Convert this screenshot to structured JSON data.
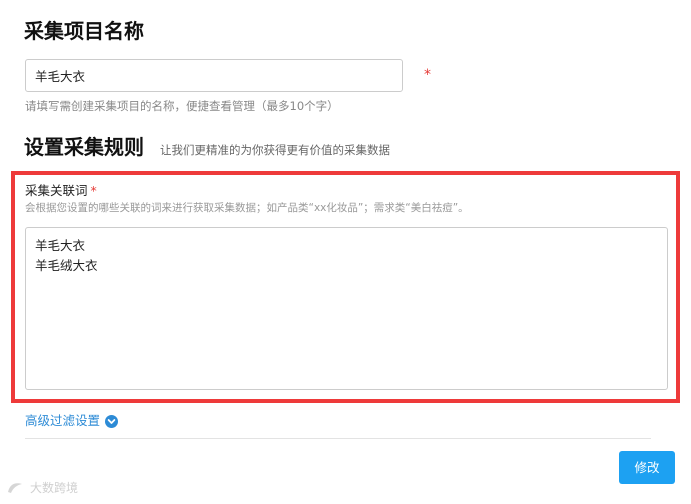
{
  "form": {
    "project_name_title": "采集项目名称",
    "project_name_value": "羊毛大衣",
    "required_mark": "*",
    "project_name_help": "请填写需创建采集项目的名称，便捷查看管理（最多10个字）",
    "rules_title": "设置采集规则",
    "rules_subtitle": "让我们更精准的为你获得更有价值的采集数据",
    "keywords_label": "采集关联词",
    "keywords_hint": "会根据您设置的哪些关联的词来进行获取采集数据；如产品类“xx化妆品”；需求类“美白祛痘”。",
    "keywords": [
      "羊毛大衣",
      "羊毛绒大衣"
    ],
    "advanced_filter_label": "高级过滤设置",
    "submit_label": "修改"
  },
  "watermark": {
    "text": "大数跨境"
  },
  "colors": {
    "highlight_border": "#ee3a3a",
    "link": "#2d8bd6",
    "primary_button": "#1da1f2",
    "required": "#e53935"
  },
  "icons": {
    "advanced_toggle": "chevron-down-circle-icon"
  }
}
